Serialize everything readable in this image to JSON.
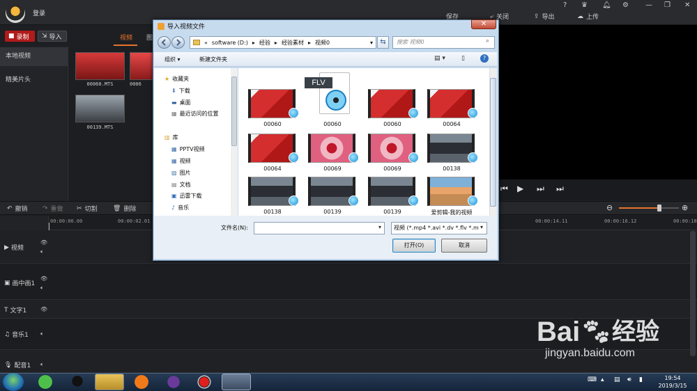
{
  "app": {
    "login": "登录",
    "actions": {
      "save": "保存",
      "close": "关闭",
      "export": "导出",
      "upload": "上传"
    },
    "window_controls": {
      "help": "?"
    },
    "record_button": "录制",
    "import_button": "导入",
    "media_tabs": [
      "视频",
      "图"
    ],
    "left_nav": [
      "本地视频",
      "精美片头"
    ],
    "media_items": [
      {
        "name": "00060.MTS"
      },
      {
        "name": "0006"
      },
      {
        "name": "00139.MTS"
      }
    ],
    "edit_toolbar": {
      "undo": "撤销",
      "redo": "重做",
      "cut": "切割",
      "delete": "删除"
    },
    "ruler_ticks": [
      "00:00:00.00",
      "00:00:02.01",
      "00:00:14.11",
      "00:00:16.12",
      "00:00:18."
    ],
    "tracks": [
      "视频",
      "画中画1",
      "文字1",
      "音乐1",
      "配音1"
    ]
  },
  "dialog": {
    "title": "导入视频文件",
    "close": "✕",
    "address": {
      "prefix": "«",
      "segments": [
        "software (D:)",
        "经验",
        "经验素材",
        "视频0"
      ]
    },
    "search_placeholder": "搜索 视频0",
    "command_bar": {
      "organize": "组织 ▾",
      "new_folder": "新建文件夹"
    },
    "nav": {
      "favorites": "收藏夹",
      "favorite_items": [
        "下载",
        "桌面",
        "最近访问的位置"
      ],
      "libraries": "库",
      "library_items": [
        "PPTV视频",
        "视频",
        "图片",
        "文档",
        "迅雷下载",
        "音乐"
      ]
    },
    "files": [
      {
        "name": "00060",
        "kind": "red"
      },
      {
        "name": "00060",
        "kind": "flv",
        "badge": "FLV"
      },
      {
        "name": "00060",
        "kind": "red"
      },
      {
        "name": "00064",
        "kind": "red"
      },
      {
        "name": "00064",
        "kind": "red"
      },
      {
        "name": "00069",
        "kind": "pink"
      },
      {
        "name": "00069",
        "kind": "pink"
      },
      {
        "name": "00138",
        "kind": "car"
      },
      {
        "name": "00138",
        "kind": "car"
      },
      {
        "name": "00139",
        "kind": "car"
      },
      {
        "name": "00139",
        "kind": "car"
      },
      {
        "name": "爱剪辑-我的视频",
        "kind": "sunset"
      }
    ],
    "filename_label": "文件名(N):",
    "filename_value": "",
    "filetype": "视频 (*.mp4 *.avi *.dv *.flv *.m",
    "open_button": "打开(O)",
    "cancel_button": "取消"
  },
  "taskbar": {
    "time": "19:54",
    "date": "2019/3/15"
  },
  "watermark": {
    "brand": "Bai",
    "brand2": "经验",
    "url": "jingyan.baidu.com"
  },
  "colors": {
    "accent": "#e8742c",
    "record": "#b01b1b",
    "dialog_chrome": "#c7dbef"
  }
}
